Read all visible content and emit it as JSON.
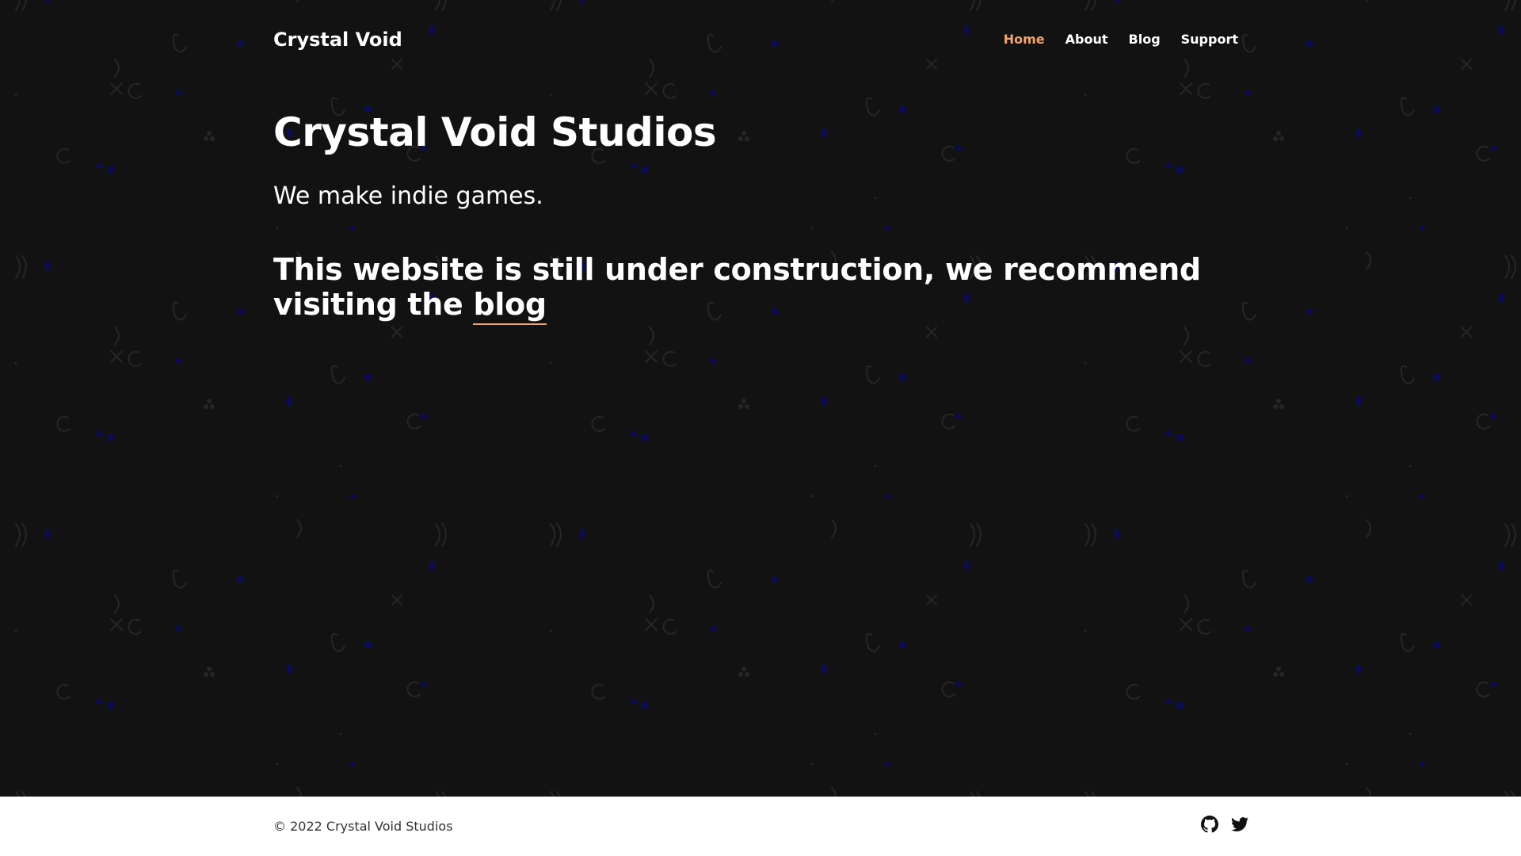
{
  "colors": {
    "background": "#121212",
    "accent": "#f5a46c",
    "text": "#ffffff",
    "footer_background": "#ffffff",
    "pattern_dark_blue": "#0b0b5a"
  },
  "nav": {
    "brand": "Crystal Void",
    "items": [
      {
        "label": "Home",
        "active": true
      },
      {
        "label": "About",
        "active": false
      },
      {
        "label": "Blog",
        "active": false
      },
      {
        "label": "Support",
        "active": false
      }
    ]
  },
  "hero": {
    "title": "Crystal Void Studios",
    "tagline": "We make indie games.",
    "notice_text": "This website is still under construction, we recommend visiting the ",
    "notice_link": "blog"
  },
  "footer": {
    "copyright": "© 2022 Crystal Void Studios",
    "icons": [
      "github-icon",
      "twitter-icon"
    ]
  }
}
